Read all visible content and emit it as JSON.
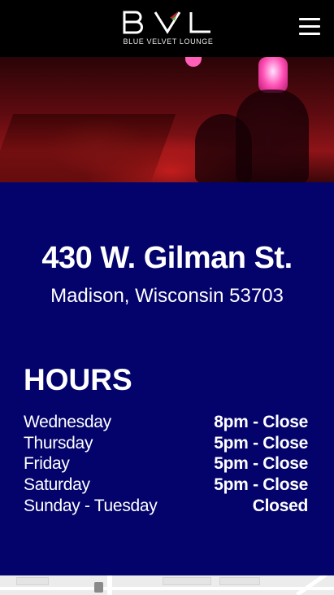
{
  "header": {
    "logo_text": "BVL",
    "logo_subtitle": "BLUE VELVET LOUNGE",
    "menu_icon": "hamburger-menu-icon"
  },
  "hero": {
    "image": "bar interior photo with red lighting"
  },
  "address": {
    "street": "430 W. Gilman St.",
    "city_state_zip": "Madison, Wisconsin 53703"
  },
  "hours": {
    "title": "HOURS",
    "rows": [
      {
        "day": "Wednesday",
        "time": "8pm - Close"
      },
      {
        "day": "Thursday",
        "time": "5pm - Close"
      },
      {
        "day": "Friday",
        "time": "5pm - Close"
      },
      {
        "day": "Saturday",
        "time": "5pm - Close"
      },
      {
        "day": "Sunday - Tuesday",
        "time": "Closed"
      }
    ]
  },
  "colors": {
    "header_bg": "#000000",
    "info_bg": "#03036b",
    "text": "#ffffff"
  }
}
